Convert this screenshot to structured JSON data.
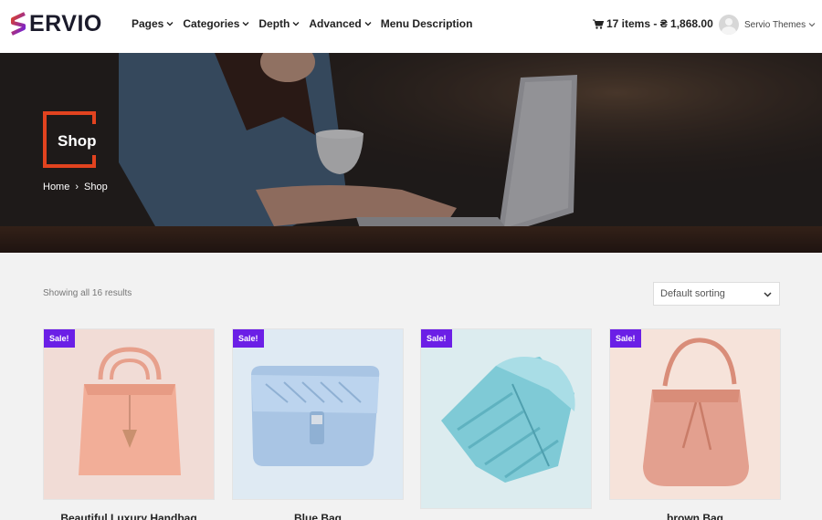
{
  "brand": {
    "logo_letter": "S",
    "name": "ERVIO"
  },
  "nav": {
    "items": [
      {
        "label": "Pages",
        "has_dropdown": true
      },
      {
        "label": "Categories",
        "has_dropdown": true
      },
      {
        "label": "Depth",
        "has_dropdown": true
      },
      {
        "label": "Advanced",
        "has_dropdown": true
      },
      {
        "label": "Menu Description",
        "has_dropdown": false
      }
    ]
  },
  "cart": {
    "summary": "17 items - ₴ 1,868.00",
    "icon": "cart-icon"
  },
  "user": {
    "name": "Servio Themes"
  },
  "hero": {
    "title": "Shop",
    "breadcrumb": {
      "home": "Home",
      "separator": "›",
      "current": "Shop"
    }
  },
  "shop": {
    "result_count": "Showing all 16 results",
    "sort_selected": "Default sorting"
  },
  "products": [
    {
      "badge": "Sale!",
      "name": "Beautiful Luxury Handbag",
      "bg": "#f1dcd6"
    },
    {
      "badge": "Sale!",
      "name": "Blue Bag",
      "bg": "#dfeaf3"
    },
    {
      "badge": "Sale!",
      "name": "",
      "bg": "#dcecef"
    },
    {
      "badge": "Sale!",
      "name": "brown Bag",
      "bg": "#f6e3da"
    }
  ],
  "colors": {
    "accent": "#e2431f",
    "sale_badge": "#6b1fe6",
    "logo_gradient_start": "#e2431f",
    "logo_gradient_end": "#6b1fe6"
  }
}
